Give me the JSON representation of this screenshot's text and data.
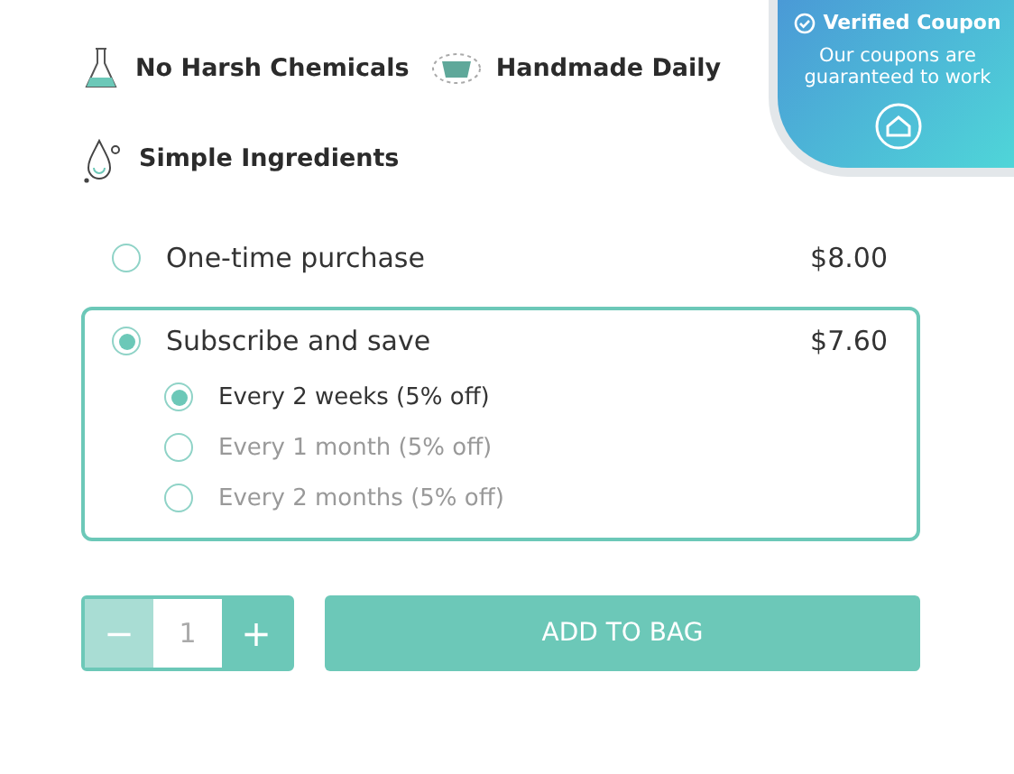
{
  "features": [
    {
      "kind": "flask",
      "label": "No Harsh Chemicals"
    },
    {
      "kind": "bowl",
      "label": "Handmade Daily"
    },
    {
      "kind": "drop",
      "label": "Simple Ingredients"
    }
  ],
  "coupon": {
    "title": "Verified Coupon",
    "text": "Our coupons are guaranteed to work"
  },
  "purchase_options": [
    {
      "label": "One-time purchase",
      "price": "$8.00",
      "selected": false
    },
    {
      "label": "Subscribe and save",
      "price": "$7.60",
      "selected": true,
      "frequencies": [
        {
          "label": "Every 2 weeks (5% off)",
          "selected": true
        },
        {
          "label": "Every 1 month (5% off)",
          "selected": false
        },
        {
          "label": "Every 2 months (5% off)",
          "selected": false
        }
      ]
    }
  ],
  "quantity": {
    "value": "1",
    "decrement": "−",
    "increment": "+",
    "decrement_disabled": true
  },
  "add_button": "ADD TO BAG"
}
